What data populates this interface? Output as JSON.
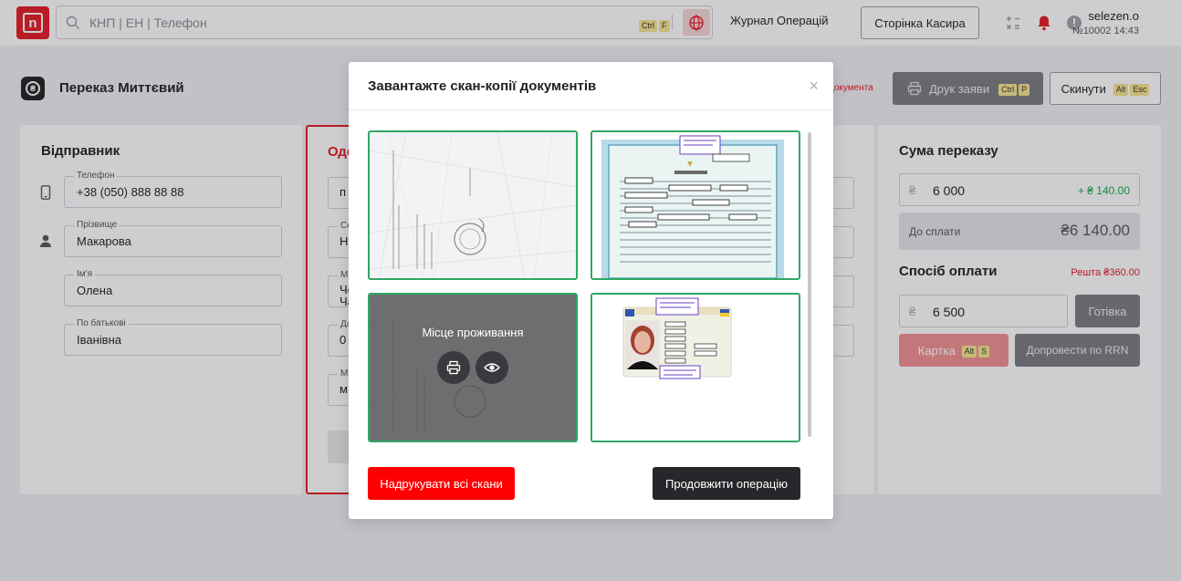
{
  "header": {
    "logo_text": "n",
    "search_placeholder": "КНП | ЕН | Телефон",
    "search_hotkey": [
      "Ctrl",
      "F"
    ],
    "journal_link": "Журнал Операцій",
    "cashier_button": "Сторінка Касира",
    "user_name": "selezen.o",
    "user_meta": "№10002 14:43"
  },
  "page": {
    "title": "Переказ Миттєвий",
    "doc_warning": "документа",
    "print_button": "Друк заяви",
    "print_hotkey": [
      "Ctrl",
      "P"
    ],
    "reset_button": "Скинути",
    "reset_hotkey": [
      "Alt",
      "Esc"
    ]
  },
  "sender": {
    "heading": "Відправник",
    "fields": [
      {
        "label": "Телефон",
        "value": "+38 (050) 888 88 88"
      },
      {
        "label": "Прізвище",
        "value": "Макарова"
      },
      {
        "label": "Ім'я",
        "value": "Олена"
      },
      {
        "label": "По батькові",
        "value": "Іванівна"
      }
    ]
  },
  "recipient": {
    "heading": "Оде",
    "fields": [
      {
        "label": "",
        "value": "п"
      },
      {
        "label": "Се",
        "value": "Н"
      },
      {
        "label": "М",
        "value": "Че\nЧа"
      },
      {
        "label": "Да",
        "value": "0"
      },
      {
        "label": "М",
        "value": "м."
      }
    ]
  },
  "summary": {
    "heading": "Сума переказу",
    "currency_symbol": "₴",
    "amount": "6 000",
    "fee": "+ ₴ 140.00",
    "to_pay_label": "До сплати",
    "to_pay_value": "₴6 140.00",
    "payment_heading": "Спосіб оплати",
    "change": "Решта ₴360.00",
    "cash_amount": "6 500",
    "cash_button": "Готівка",
    "card_button": "Картка",
    "card_hotkey": [
      "Alt",
      "S"
    ],
    "rrn_button": "Допровести по RRN"
  },
  "modal": {
    "title": "Завантажте скан-копії документів",
    "close_icon": "×",
    "hover_caption": "Місце проживання",
    "print_all_button": "Надрукувати всі скани",
    "continue_button": "Продовжити операцію"
  },
  "colors": {
    "brand_red": "#e41b23",
    "success_green": "#2fa862",
    "dark_button": "#27272b"
  }
}
